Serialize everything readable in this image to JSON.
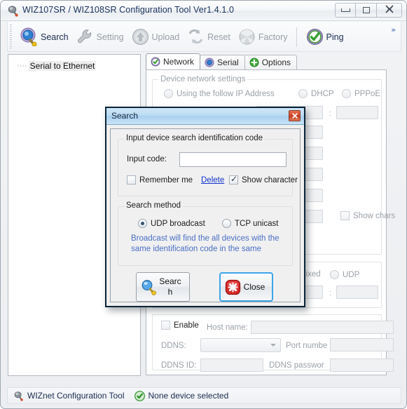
{
  "window": {
    "title": "WIZ107SR / WIZ108SR Configuration Tool Ver1.4.1.0",
    "icon": "app-wiznet-icon",
    "controls": {
      "minimize": "minimize-button",
      "maximize": "maximize-button",
      "close": "close-button"
    }
  },
  "toolbar": {
    "overflow_glyph": "»",
    "items": [
      {
        "label": "Search",
        "icon": "magnifier-icon",
        "enabled": true
      },
      {
        "label": "Setting",
        "icon": "wrench-icon",
        "enabled": false
      },
      {
        "label": "Upload",
        "icon": "upload-arrow-icon",
        "enabled": false
      },
      {
        "label": "Reset",
        "icon": "refresh-arrows-icon",
        "enabled": false
      },
      {
        "label": "Factory",
        "icon": "fan-circle-icon",
        "enabled": false
      },
      {
        "label": "Ping",
        "icon": "green-check-icon",
        "enabled": true
      }
    ]
  },
  "tree": {
    "dots": "····",
    "root_label": "Serial to Ethernet"
  },
  "tabs": [
    {
      "label": "Network",
      "icon": "network-check-icon",
      "active": true
    },
    {
      "label": "Serial",
      "icon": "serial-dot-icon",
      "active": false
    },
    {
      "label": "Options",
      "icon": "options-plus-icon",
      "active": false
    }
  ],
  "network_tab": {
    "device_network_settings": {
      "title": "Device network settings",
      "modes": [
        {
          "label": "Using the follow IP Address",
          "selected": false
        },
        {
          "label": "DHCP",
          "selected": false
        },
        {
          "label": "PPPoE",
          "selected": false
        }
      ],
      "fields": [
        {
          "value": "",
          "value2": ""
        },
        {
          "value": ""
        },
        {
          "value": ""
        },
        {
          "value": ""
        },
        {
          "value": ""
        },
        {
          "value": ""
        }
      ],
      "show_chars_label": "Show chars",
      "show_chars_checked": false,
      "colon": ":"
    },
    "operation_mode": {
      "mixed_label": "CP mixed",
      "udp_label": "UDP",
      "udp_selected": false,
      "port_value": "",
      "port_value2": "",
      "colon": ":"
    },
    "ddns": {
      "enable_label": "Enable",
      "enable_checked": false,
      "host_name_label": "Host name:",
      "host_name_value": "",
      "ddns_label": "DDNS:",
      "ddns_value": "",
      "port_number_label": "Port numbe",
      "port_number_value": "",
      "ddns_id_label": "DDNS ID:",
      "ddns_id_value": "",
      "ddns_password_label": "DDNS passwor",
      "ddns_password_value": ""
    }
  },
  "statusbar": {
    "app_icon": "app-wiznet-icon",
    "app_label": "WIZnet Configuration Tool",
    "status_icon": "green-check-icon",
    "status_label": "None device selected"
  },
  "dialog": {
    "title": "Search",
    "close_glyph": "✖",
    "id_group": {
      "title": "Input device search identification code",
      "input_code_label": "Input code:",
      "input_code_value": "",
      "input_code_placeholder": "",
      "remember_me_label": "Remember me",
      "remember_me_checked": false,
      "delete_link": "Delete",
      "show_character_label": "Show character",
      "show_character_checked": true
    },
    "method_group": {
      "title": "Search method",
      "udp_label": "UDP broadcast",
      "udp_selected": true,
      "tcp_label": "TCP unicast",
      "tcp_selected": false,
      "hint_line1": "Broadcast will find the all devices with the",
      "hint_line2": "same identification code in the same"
    },
    "buttons": {
      "search_label": "Search",
      "search_icon": "magnifier-icon",
      "close_label": "Close",
      "close_icon": "red-x-icon",
      "close_focused": true
    }
  },
  "colors": {
    "title_text": "#19305e",
    "dialog_titlebar": "#bcdcf3",
    "hint_blue": "#4a6fc4",
    "link_blue": "#1233cc",
    "accent_green": "#35a02e",
    "close_red": "#d1452a",
    "focus_blue": "#3da5e8",
    "disabled_gray": "#9aa0a7"
  }
}
